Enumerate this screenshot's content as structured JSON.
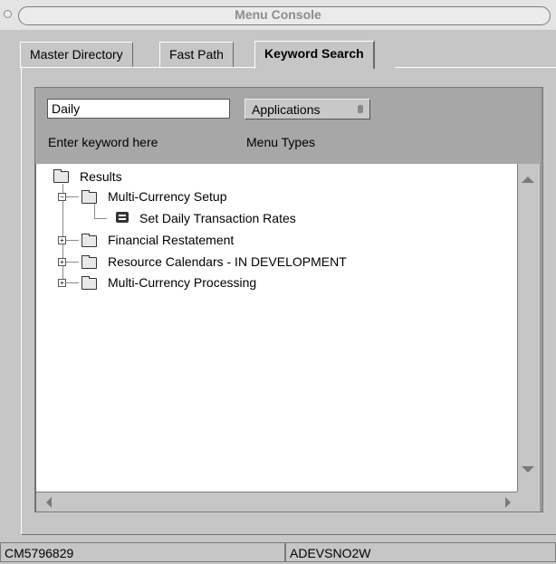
{
  "window": {
    "title": "Menu Console"
  },
  "tabs": [
    {
      "label": "Master Directory"
    },
    {
      "label": "Fast Path"
    },
    {
      "label": "Keyword Search"
    }
  ],
  "search": {
    "keyword_value": "Daily",
    "keyword_caption": "Enter keyword here",
    "menu_type_value": "Applications",
    "menu_type_caption": "Menu Types"
  },
  "tree": {
    "root": "Results",
    "items": [
      {
        "label": "Multi-Currency Setup",
        "expanded": true,
        "icon": "folder-icon",
        "children": [
          {
            "label": "Set Daily Transaction Rates",
            "icon": "application-icon"
          }
        ]
      },
      {
        "label": "Financial Restatement",
        "expanded": false,
        "icon": "folder-icon"
      },
      {
        "label": "Resource Calendars - IN DEVELOPMENT",
        "expanded": false,
        "icon": "folder-icon"
      },
      {
        "label": "Multi-Currency Processing",
        "expanded": false,
        "icon": "folder-icon"
      }
    ]
  },
  "status": {
    "left": "CM5796829",
    "right": "ADEVSNO2W"
  }
}
